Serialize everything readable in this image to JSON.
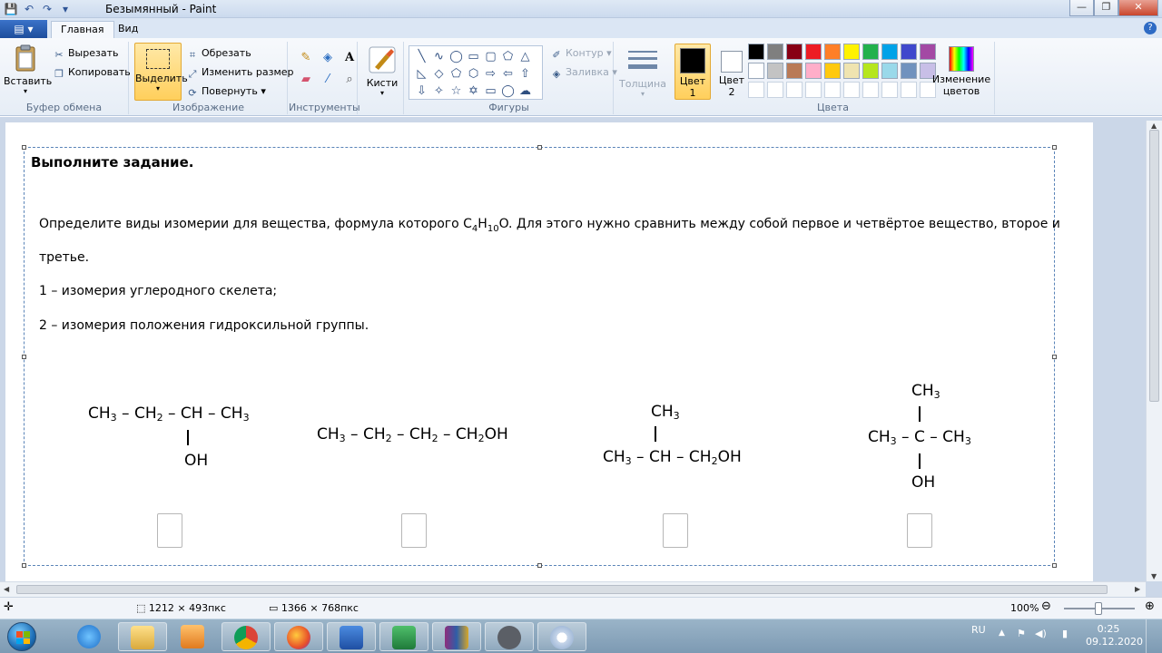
{
  "window": {
    "title": "Безымянный - Paint",
    "controls": [
      "—",
      "❐",
      "✕"
    ]
  },
  "quick_access": [
    "💾",
    "↶",
    "↷",
    "▾"
  ],
  "tabs": [
    {
      "label": "Главная",
      "active": true
    },
    {
      "label": "Вид",
      "active": false
    }
  ],
  "ribbon": {
    "clipboard": {
      "paste": "Вставить",
      "cut": "Вырезать",
      "copy": "Копировать",
      "label": "Буфер обмена"
    },
    "image": {
      "select": "Выделить",
      "crop": "Обрезать",
      "resize": "Изменить размер",
      "rotate": "Повернуть",
      "label": "Изображение"
    },
    "tools": {
      "label": "Инструменты"
    },
    "brushes": {
      "label": "Кисти"
    },
    "shapes": {
      "outline": "Контур",
      "fill": "Заливка",
      "label": "Фигуры"
    },
    "size": {
      "label": "Толщина"
    },
    "colors": {
      "color1": "Цвет\n1",
      "color1_line1": "Цвет",
      "color1_line2": "1",
      "color2_line1": "Цвет",
      "color2_line2": "2",
      "edit_line1": "Изменение",
      "edit_line2": "цветов",
      "label": "Цвета",
      "palette_row1": [
        "#000000",
        "#7f7f7f",
        "#880015",
        "#ed1c24",
        "#ff7f27",
        "#fff200",
        "#22b14c",
        "#00a2e8",
        "#3f48cc",
        "#a349a4"
      ],
      "palette_row2": [
        "#ffffff",
        "#c3c3c3",
        "#b97a57",
        "#ffaec9",
        "#ffc90e",
        "#efe4b0",
        "#b5e61d",
        "#99d9ea",
        "#7092be",
        "#c8bfe7"
      ]
    }
  },
  "canvas": {
    "task_title": "Выполните задание.",
    "line1_a": "Определите виды изомерии для вещества, формула которого C",
    "line1_sub1": "4",
    "line1_b": "H",
    "line1_sub2": "10",
    "line1_c": "O. Для этого нужно сравнить между собой первое и четвёртое вещество, второе и",
    "line2": "третье.",
    "line3": "1 – изомерия углеродного скелета;",
    "line4": "2 – изомерия положения гидроксильной группы.",
    "oh": "OH",
    "ch3": "CH",
    "sub3": "3"
  },
  "statusbar": {
    "selection_size": "1212 × 493пкс",
    "image_size": "1366 × 768пкс",
    "zoom": "100%"
  },
  "taskbar": {
    "lang": "RU",
    "time": "0:25",
    "date": "09.12.2020"
  }
}
